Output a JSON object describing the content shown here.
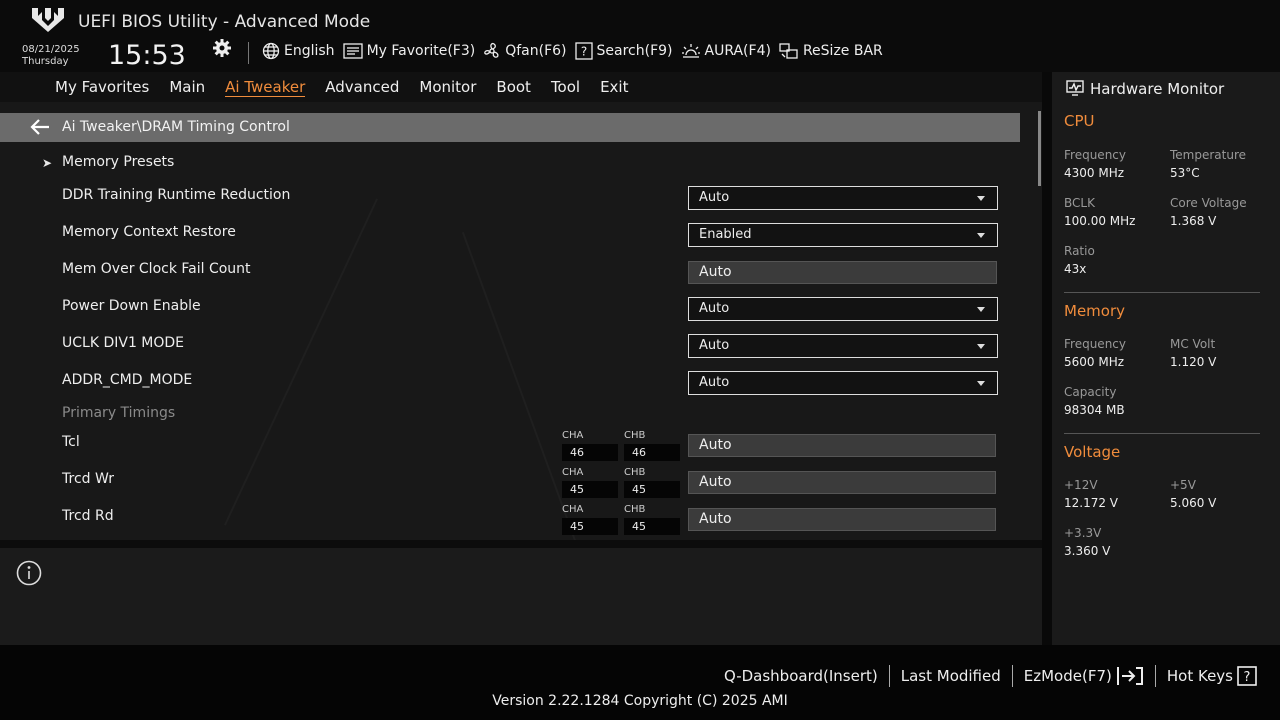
{
  "header": {
    "title": "UEFI BIOS Utility - Advanced Mode",
    "date": "08/21/2025",
    "day": "Thursday",
    "time": "15:53",
    "toolbar": [
      {
        "label": "English",
        "icon": "globe-icon"
      },
      {
        "label": "My Favorite(F3)",
        "icon": "favorite-icon"
      },
      {
        "label": "Qfan(F6)",
        "icon": "fan-icon"
      },
      {
        "label": "Search(F9)",
        "icon": "search-icon"
      },
      {
        "label": "AURA(F4)",
        "icon": "aura-icon"
      },
      {
        "label": "ReSize BAR",
        "icon": "resize-bar-icon"
      }
    ]
  },
  "nav": {
    "tabs": [
      "My Favorites",
      "Main",
      "Ai Tweaker",
      "Advanced",
      "Monitor",
      "Boot",
      "Tool",
      "Exit"
    ],
    "active": "Ai Tweaker"
  },
  "main": {
    "path": "Ai Tweaker\\DRAM Timing Control",
    "items": [
      {
        "label": "Memory Presets",
        "type": "submenu"
      },
      {
        "label": "DDR Training Runtime Reduction",
        "type": "select",
        "value": "Auto"
      },
      {
        "label": "Memory Context Restore",
        "type": "select",
        "value": "Enabled"
      },
      {
        "label": "Mem Over Clock Fail Count",
        "type": "input",
        "value": "Auto"
      },
      {
        "label": "Power Down Enable",
        "type": "select",
        "value": "Auto"
      },
      {
        "label": "UCLK DIV1 MODE",
        "type": "select",
        "value": "Auto"
      },
      {
        "label": "ADDR_CMD_MODE",
        "type": "select",
        "value": "Auto"
      },
      {
        "label": "Primary Timings",
        "type": "group"
      },
      {
        "label": "Tcl",
        "type": "timing",
        "cha": "46",
        "chb": "46",
        "value": "Auto"
      },
      {
        "label": "Trcd Wr",
        "type": "timing",
        "cha": "45",
        "chb": "45",
        "value": "Auto"
      },
      {
        "label": "Trcd Rd",
        "type": "timing",
        "cha": "45",
        "chb": "45",
        "value": "Auto"
      }
    ],
    "cha_label": "CHA",
    "chb_label": "CHB"
  },
  "hardware_monitor": {
    "title": "Hardware Monitor",
    "cpu": {
      "title": "CPU",
      "frequency_label": "Frequency",
      "frequency": "4300 MHz",
      "temperature_label": "Temperature",
      "temperature": "53°C",
      "bclk_label": "BCLK",
      "bclk": "100.00 MHz",
      "core_voltage_label": "Core Voltage",
      "core_voltage": "1.368 V",
      "ratio_label": "Ratio",
      "ratio": "43x"
    },
    "memory": {
      "title": "Memory",
      "frequency_label": "Frequency",
      "frequency": "5600 MHz",
      "mc_volt_label": "MC Volt",
      "mc_volt": "1.120 V",
      "capacity_label": "Capacity",
      "capacity": "98304 MB"
    },
    "voltage": {
      "title": "Voltage",
      "v12_label": "+12V",
      "v12": "12.172 V",
      "v5_label": "+5V",
      "v5": "5.060 V",
      "v33_label": "+3.3V",
      "v33": "3.360 V"
    }
  },
  "footer": {
    "items": [
      "Q-Dashboard(Insert)",
      "Last Modified",
      "EzMode(F7)",
      "Hot Keys"
    ],
    "version": "Version 2.22.1284 Copyright (C) 2025 AMI"
  },
  "colors": {
    "accent": "#f08c3c",
    "background": "#181818",
    "path_bar": "#6b6b6b"
  }
}
